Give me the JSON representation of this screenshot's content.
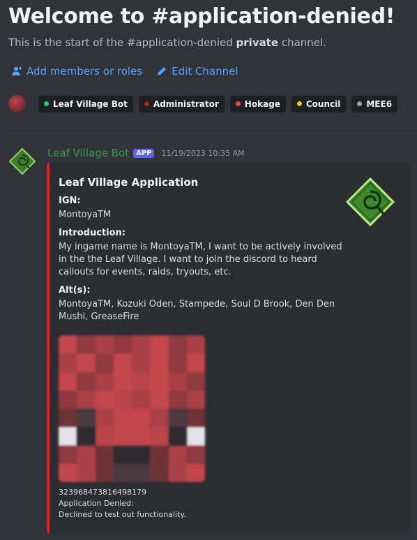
{
  "header": {
    "title": "Welcome to #application-denied!",
    "subtitle_prefix": "This is the start of the #application-denied ",
    "subtitle_bold": "private",
    "subtitle_suffix": " channel."
  },
  "actions": {
    "add_members": "Add members or roles",
    "edit_channel": "Edit Channel"
  },
  "roles": [
    {
      "name": "Leaf Village Bot",
      "color": "#2ecc71"
    },
    {
      "name": "Administrator",
      "color": "#992d22"
    },
    {
      "name": "Hokage",
      "color": "#e74c3c"
    },
    {
      "name": "Council",
      "color": "#f1c40f"
    },
    {
      "name": "MEE6",
      "color": "#95a5a6"
    }
  ],
  "message": {
    "author": "Leaf Village Bot",
    "badge": "APP",
    "timestamp": "11/19/2023 10:35 AM",
    "embed": {
      "accent_color": "#ed1c24",
      "title": "Leaf Village Application",
      "fields": [
        {
          "name": "IGN:",
          "lines": [
            "MontoyaTM"
          ]
        },
        {
          "name": "Introduction:",
          "lines": [
            "My ingame name is MontoyaTM, I want to be actively involved",
            "in the the Leaf Village. I want to join the discord to heard",
            "callouts for events, raids, tryouts, etc."
          ]
        },
        {
          "name": "Alt(s):",
          "lines": [
            "MontoyaTM, Kozuki Oden, Stampede, Soul D Brook, Den Den",
            "Mushi, GreaseFire"
          ]
        }
      ],
      "footer": [
        "323968473816498179",
        "Application Denied:",
        "Declined to test out functionality."
      ]
    }
  }
}
